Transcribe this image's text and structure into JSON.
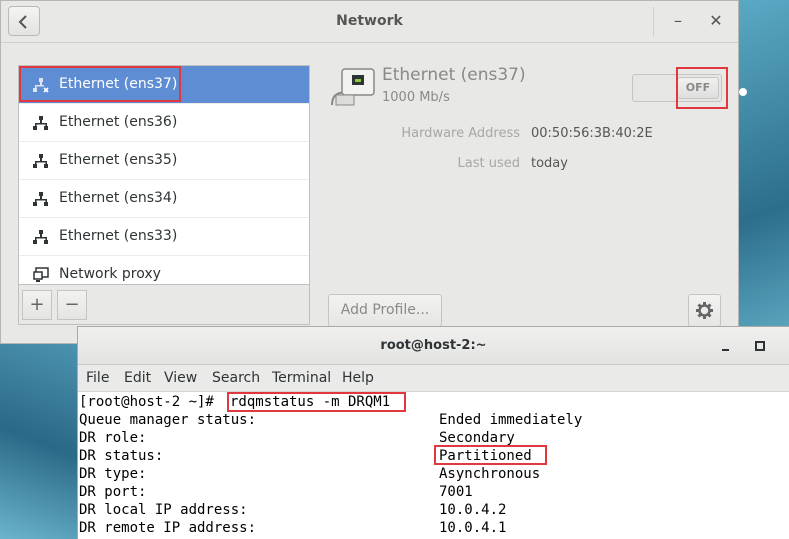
{
  "network_window": {
    "title": "Network",
    "back_icon": "chevron-left-icon",
    "minimize_glyph": "–",
    "close_glyph": "✕",
    "connections": [
      {
        "label": "Ethernet (ens37)",
        "icon": "wired-network-disabled-icon",
        "selected": true
      },
      {
        "label": "Ethernet (ens36)",
        "icon": "wired-network-icon",
        "selected": false
      },
      {
        "label": "Ethernet (ens35)",
        "icon": "wired-network-icon",
        "selected": false
      },
      {
        "label": "Ethernet (ens34)",
        "icon": "wired-network-icon",
        "selected": false
      },
      {
        "label": "Ethernet (ens33)",
        "icon": "wired-network-icon",
        "selected": false
      },
      {
        "label": "Network proxy",
        "icon": "network-proxy-icon",
        "selected": false
      }
    ],
    "list_toolbar": {
      "add": "+",
      "remove": "−"
    },
    "device": {
      "name": "Ethernet (ens37)",
      "speed": "1000 Mb/s",
      "toggle_state": "OFF",
      "details": [
        {
          "label": "Hardware Address",
          "value": "00:50:56:3B:40:2E"
        },
        {
          "label": "Last used",
          "value": "today"
        }
      ],
      "add_profile": "Add Profile...",
      "settings_icon": "gear-icon"
    }
  },
  "terminal": {
    "title": "root@host-2:~",
    "menu": [
      "File",
      "Edit",
      "View",
      "Search",
      "Terminal",
      "Help"
    ],
    "prompt": "[root@host-2 ~]#",
    "command": "rdqmstatus -m DRQM1",
    "rows": [
      {
        "key": "Queue manager status:",
        "value": "Ended immediately"
      },
      {
        "key": "DR role:",
        "value": "Secondary"
      },
      {
        "key": "DR status:",
        "value": "Partitioned"
      },
      {
        "key": "DR type:",
        "value": "Asynchronous"
      },
      {
        "key": "DR port:",
        "value": "7001"
      },
      {
        "key": "DR local IP address:",
        "value": "10.0.4.2"
      },
      {
        "key": "DR remote IP address:",
        "value": "10.0.4.1"
      }
    ]
  },
  "colors": {
    "selection": "#5f8dd3",
    "highlight": "#e0383e"
  }
}
